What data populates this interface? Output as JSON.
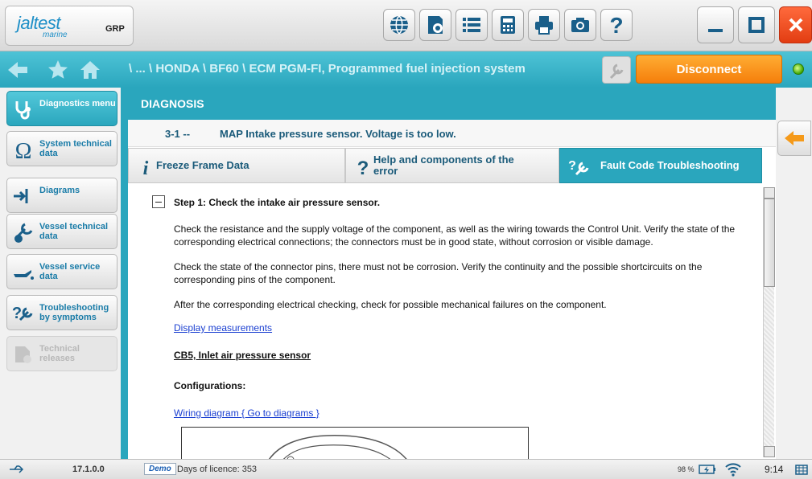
{
  "app": {
    "logo_main": "jaltest",
    "logo_sub": "marine",
    "grp_label": "GRP"
  },
  "toolbar": {
    "icons": [
      "globe-icon",
      "settings-icon",
      "list-icon",
      "calculator-icon",
      "print-icon",
      "camera-icon",
      "help-icon"
    ]
  },
  "nav": {
    "breadcrumb": "\\ ... \\ HONDA \\ BF60 \\ ECM PGM-FI, Programmed fuel injection system",
    "disconnect_label": "Disconnect"
  },
  "sidebar": {
    "items": [
      {
        "label": "Diagnostics menu",
        "icon": "stethoscope-icon",
        "state": "active"
      },
      {
        "label": "System technical data",
        "icon": "ohm-icon",
        "state": "normal"
      },
      {
        "label": "Diagrams",
        "icon": "diagram-icon",
        "state": "normal"
      },
      {
        "label": "Vessel technical data",
        "icon": "wrench-globe-icon",
        "state": "normal"
      },
      {
        "label": "Vessel service data",
        "icon": "oil-can-icon",
        "state": "normal"
      },
      {
        "label": "Troubleshooting by symptoms",
        "icon": "troubleshooting-icon",
        "state": "normal"
      },
      {
        "label": "Technical releases",
        "icon": "release-icon",
        "state": "disabled"
      }
    ]
  },
  "main": {
    "header": "DIAGNOSIS",
    "fault_code": "3-1  --",
    "fault_description": "MAP Intake pressure sensor. Voltage is too low.",
    "tabs": [
      {
        "label": "Freeze Frame Data",
        "active": false
      },
      {
        "label": "Help and components of the error",
        "active": false
      },
      {
        "label": "Fault Code Troubleshooting",
        "active": true
      }
    ],
    "step_title": "Step 1: Check the intake air pressure sensor.",
    "paragraphs": [
      "Check the resistance and the supply voltage of the component, as well as the wiring towards the Control Unit. Verify the state of the corresponding electrical connections; the connectors must be in good state, without corrosion or visible damage.",
      "Check the state of the connector pins, there must not be corrosion. Verify the continuity and the possible shortcircuits on the corresponding pins of the component.",
      "After the corresponding electrical checking, check for possible mechanical failures on the component."
    ],
    "display_measurements_link": "Display measurements",
    "component_label": "CB5, Inlet air pressure sensor",
    "configurations_label": "Configurations:",
    "wiring_diagram_link": "Wiring diagram { Go to diagrams }"
  },
  "status": {
    "version": "17.1.0.0",
    "demo_badge": "Demo",
    "licence_text": "Days of licence: 353",
    "battery_percent": "98 %",
    "time": "9:14"
  },
  "colors": {
    "teal_primary": "#2aa6bd",
    "orange_accent": "#f57e0b",
    "close_red": "#e23d12",
    "link_blue": "#1a3fd1"
  }
}
